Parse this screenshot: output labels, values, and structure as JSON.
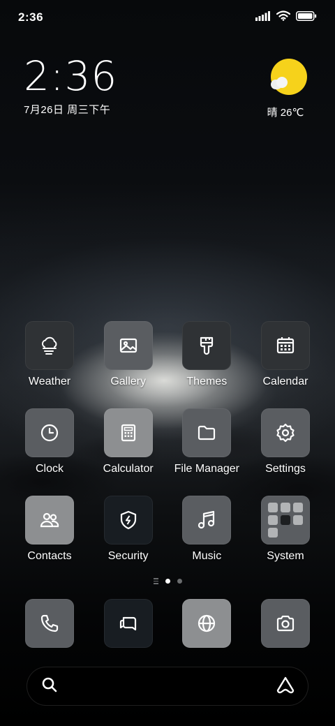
{
  "status_bar": {
    "time": "2:36",
    "icons": [
      "signal-icon",
      "wifi-icon",
      "battery-icon"
    ]
  },
  "clock_widget": {
    "time": "2:36",
    "date": "7月26日 周三下午"
  },
  "weather_widget": {
    "icon": "sun-partly-cloudy-icon",
    "text": "晴 26℃"
  },
  "apps": [
    [
      {
        "label": "Weather",
        "icon": "weather-icon",
        "style": "dark"
      },
      {
        "label": "Gallery",
        "icon": "gallery-icon",
        "style": "mid"
      },
      {
        "label": "Themes",
        "icon": "themes-icon",
        "style": "dark"
      },
      {
        "label": "Calendar",
        "icon": "calendar-icon",
        "style": "dark"
      }
    ],
    [
      {
        "label": "Clock",
        "icon": "clock-icon",
        "style": "mid"
      },
      {
        "label": "Calculator",
        "icon": "calculator-icon",
        "style": "light"
      },
      {
        "label": "File Manager",
        "icon": "folder-icon",
        "style": "mid"
      },
      {
        "label": "Settings",
        "icon": "gear-icon",
        "style": "mid"
      }
    ],
    [
      {
        "label": "Contacts",
        "icon": "contacts-icon",
        "style": "light"
      },
      {
        "label": "Security",
        "icon": "shield-icon",
        "style": "navy"
      },
      {
        "label": "Music",
        "icon": "music-note-icon",
        "style": "mid"
      },
      {
        "label": "System",
        "icon": "folder-grid-icon",
        "style": "mid"
      }
    ]
  ],
  "page_indicator": {
    "pages": 2,
    "active": 0
  },
  "dock": [
    {
      "icon": "phone-icon",
      "style": "mid"
    },
    {
      "icon": "messages-icon",
      "style": "navy"
    },
    {
      "icon": "browser-globe-icon",
      "style": "light"
    },
    {
      "icon": "camera-icon",
      "style": "mid"
    }
  ],
  "search": {
    "placeholder": "",
    "left_icon": "search-icon",
    "right_icon": "assistant-icon"
  },
  "colors": {
    "sun": "#f6d21b",
    "icon_dark": "#2f3235",
    "icon_mid": "#5a5d61",
    "icon_light": "#8d8f91",
    "icon_navy": "#181d22"
  }
}
